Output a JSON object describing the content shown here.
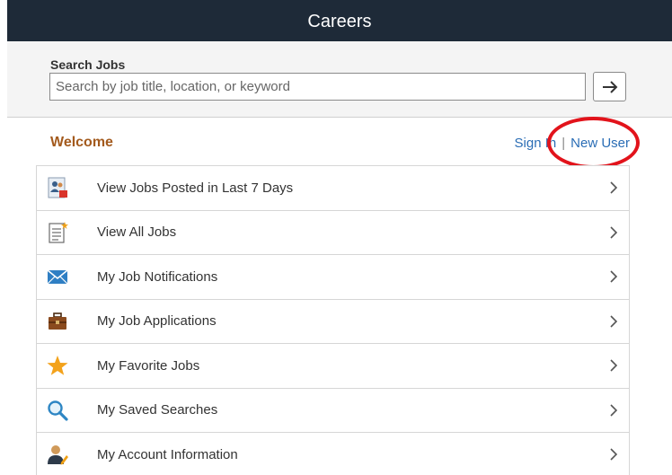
{
  "header": {
    "title": "Careers"
  },
  "search": {
    "label": "Search Jobs",
    "placeholder": "Search by job title, location, or keyword",
    "submit_icon": "arrow-right-icon"
  },
  "welcome": {
    "heading": "Welcome",
    "sign_in": "Sign In",
    "separator": "|",
    "new_user": "New User",
    "annotation_color": "#e2131b"
  },
  "menu": {
    "items": [
      {
        "label": "View Jobs Posted in Last 7 Days",
        "icon": "recent-jobs-icon"
      },
      {
        "label": "View All Jobs",
        "icon": "document-list-icon"
      },
      {
        "label": "My Job Notifications",
        "icon": "envelope-icon"
      },
      {
        "label": "My Job Applications",
        "icon": "briefcase-icon"
      },
      {
        "label": "My Favorite Jobs",
        "icon": "star-icon"
      },
      {
        "label": "My Saved Searches",
        "icon": "magnifier-icon"
      },
      {
        "label": "My Account Information",
        "icon": "user-edit-icon"
      }
    ]
  },
  "colors": {
    "header_bg": "#1e2a38",
    "welcome": "#a35a1d",
    "link": "#2a6db5"
  }
}
